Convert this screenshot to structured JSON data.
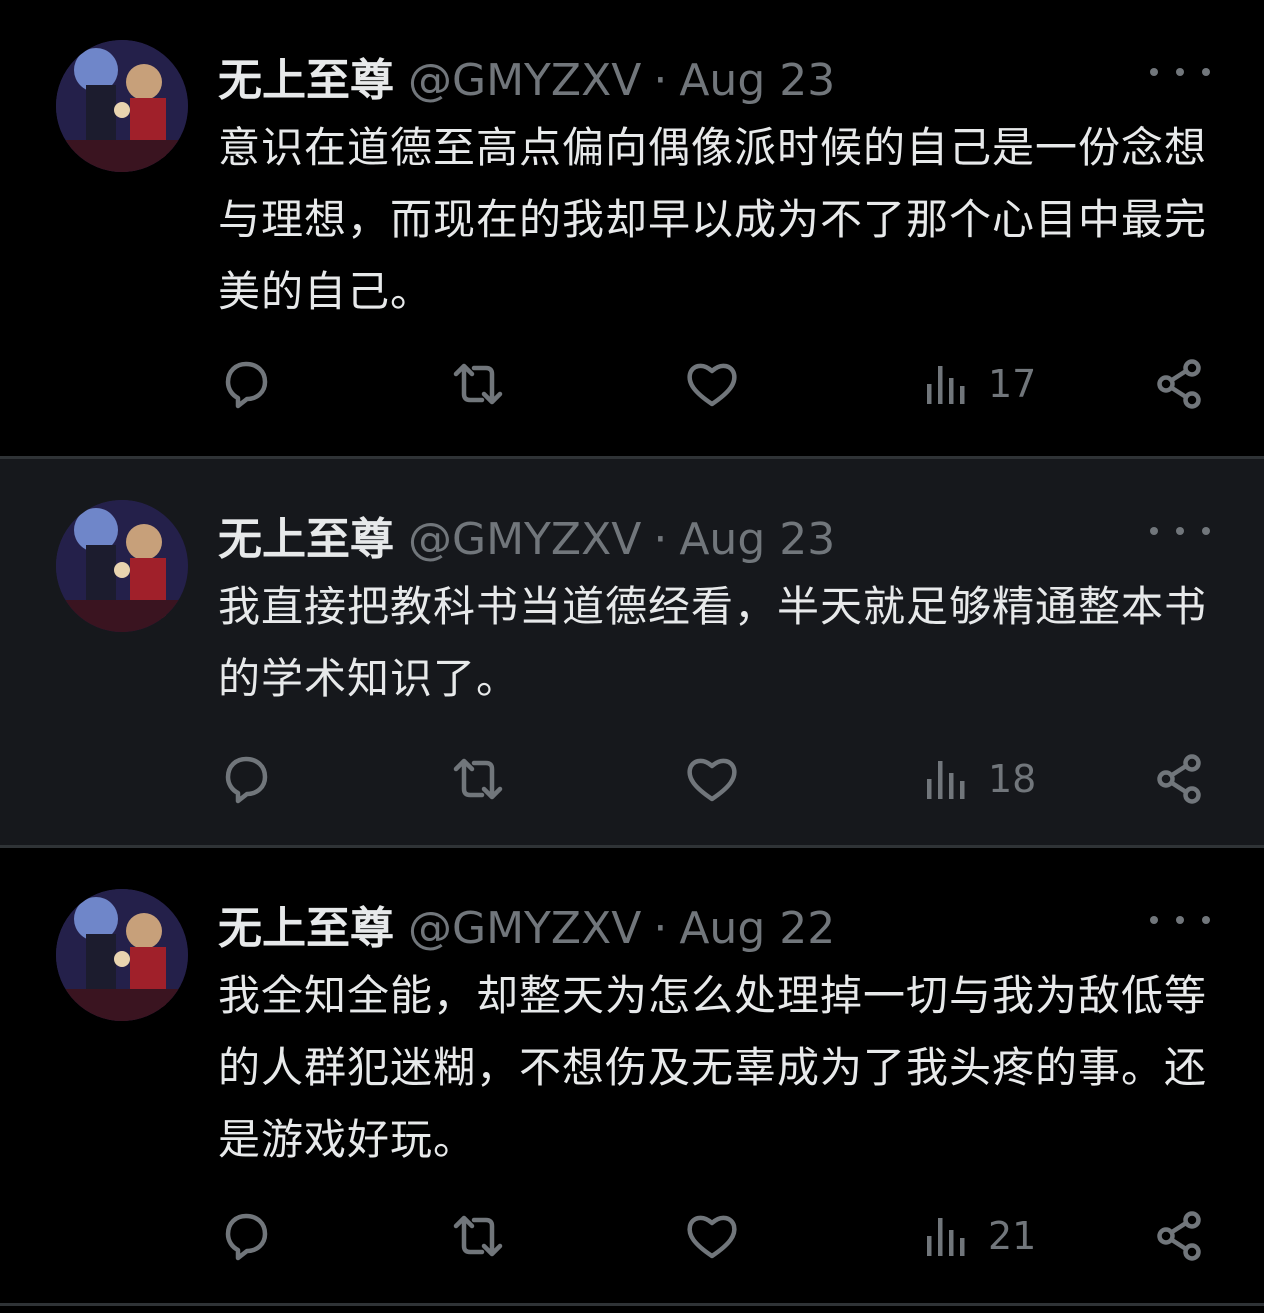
{
  "tweets": [
    {
      "name": "无上至尊",
      "handle": "@GMYZXV",
      "separator": "·",
      "date": "Aug 23",
      "text": "意识在道德至高点偏向偶像派时候的自己是一份念想与理想，而现在的我却早以成为不了那个心目中最完美的自己。",
      "views": "17"
    },
    {
      "name": "无上至尊",
      "handle": "@GMYZXV",
      "separator": "·",
      "date": "Aug 23",
      "text": "我直接把教科书当道德经看，半天就足够精通整本书的学术知识了。",
      "views": "18"
    },
    {
      "name": "无上至尊",
      "handle": "@GMYZXV",
      "separator": "·",
      "date": "Aug 22",
      "text": "我全知全能，却整天为怎么处理掉一切与我为敌低等的人群犯迷糊，不想伤及无辜成为了我头疼的事。还是游戏好玩。",
      "views": "21"
    }
  ],
  "icons": {
    "reply": "reply-icon",
    "retweet": "retweet-icon",
    "like": "heart-icon",
    "views": "views-icon",
    "share": "share-icon",
    "more": "more-icon"
  },
  "colors": {
    "background": "#000000",
    "highlight_background": "#16181c",
    "divider": "#2f3336",
    "primary_text": "#e7e9ea",
    "secondary_text": "#71767b"
  }
}
